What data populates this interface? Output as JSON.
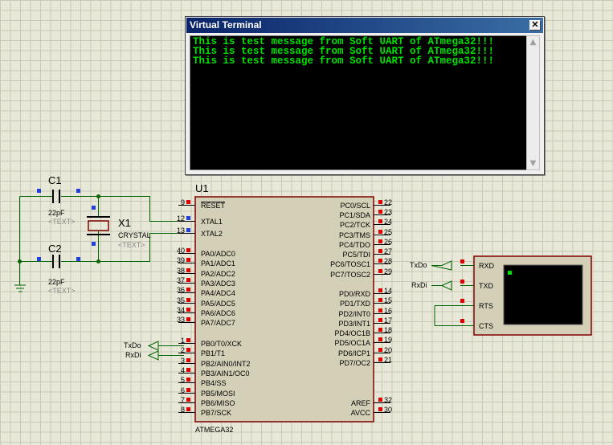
{
  "terminal_window": {
    "title": "Virtual Terminal",
    "close_glyph": "✕",
    "lines": [
      "This is test message from Soft UART of ATmega32!!!",
      "This is test message from Soft UART of ATmega32!!!",
      "This is test message from Soft UART of ATmega32!!!"
    ],
    "text_color": "#00e000",
    "scroll_up_glyph": "▲",
    "scroll_down_glyph": "▼"
  },
  "capacitor_c1": {
    "ref": "C1",
    "value": "22pF",
    "text": "<TEXT>"
  },
  "capacitor_c2": {
    "ref": "C2",
    "value": "22pF",
    "text": "<TEXT>"
  },
  "crystal": {
    "ref": "X1",
    "value": "CRYSTAL",
    "text": "<TEXT>"
  },
  "mcu": {
    "ref": "U1",
    "part": "ATMEGA32",
    "left_pins": [
      {
        "num": "9",
        "name": "RESET"
      },
      {
        "num": "12",
        "name": "XTAL1"
      },
      {
        "num": "13",
        "name": "XTAL2"
      },
      {
        "num": "40",
        "name": "PA0/ADC0"
      },
      {
        "num": "39",
        "name": "PA1/ADC1"
      },
      {
        "num": "38",
        "name": "PA2/ADC2"
      },
      {
        "num": "37",
        "name": "PA3/ADC3"
      },
      {
        "num": "36",
        "name": "PA4/ADC4"
      },
      {
        "num": "35",
        "name": "PA5/ADC5"
      },
      {
        "num": "34",
        "name": "PA6/ADC6"
      },
      {
        "num": "33",
        "name": "PA7/ADC7"
      },
      {
        "num": "1",
        "name": "PB0/T0/XCK"
      },
      {
        "num": "2",
        "name": "PB1/T1"
      },
      {
        "num": "3",
        "name": "PB2/AIN0/INT2"
      },
      {
        "num": "4",
        "name": "PB3/AIN1/OC0"
      },
      {
        "num": "5",
        "name": "PB4/SS"
      },
      {
        "num": "6",
        "name": "PB5/MOSI"
      },
      {
        "num": "7",
        "name": "PB6/MISO"
      },
      {
        "num": "8",
        "name": "PB7/SCK"
      }
    ],
    "right_pins": [
      {
        "num": "22",
        "name": "PC0/SCL"
      },
      {
        "num": "23",
        "name": "PC1/SDA"
      },
      {
        "num": "24",
        "name": "PC2/TCK"
      },
      {
        "num": "25",
        "name": "PC3/TMS"
      },
      {
        "num": "26",
        "name": "PC4/TDO"
      },
      {
        "num": "27",
        "name": "PC5/TDI"
      },
      {
        "num": "28",
        "name": "PC6/TOSC1"
      },
      {
        "num": "29",
        "name": "PC7/TOSC2"
      },
      {
        "num": "14",
        "name": "PD0/RXD"
      },
      {
        "num": "15",
        "name": "PD1/TXD"
      },
      {
        "num": "16",
        "name": "PD2/INT0"
      },
      {
        "num": "17",
        "name": "PD3/INT1"
      },
      {
        "num": "18",
        "name": "PD4/OC1B"
      },
      {
        "num": "19",
        "name": "PD5/OC1A"
      },
      {
        "num": "20",
        "name": "PD6/ICP1"
      },
      {
        "num": "21",
        "name": "PD7/OC2"
      },
      {
        "num": "32",
        "name": "AREF"
      },
      {
        "num": "30",
        "name": "AVCC"
      }
    ]
  },
  "net_labels": {
    "mcu_txdo": "TxDo",
    "mcu_rxdi": "RxDi",
    "term_txdo": "TxDo",
    "term_rxdi": "RxDi"
  },
  "terminal_device": {
    "pins": [
      "RXD",
      "TXD",
      "RTS",
      "CTS"
    ]
  },
  "colors": {
    "wire": "#006400",
    "component": "#800000",
    "text": "#000000",
    "chip_fill": "#d4d0b8",
    "placeholder_text": "#888888",
    "pin_square_red": "#e00000",
    "pin_square_blue": "#2040e0"
  }
}
